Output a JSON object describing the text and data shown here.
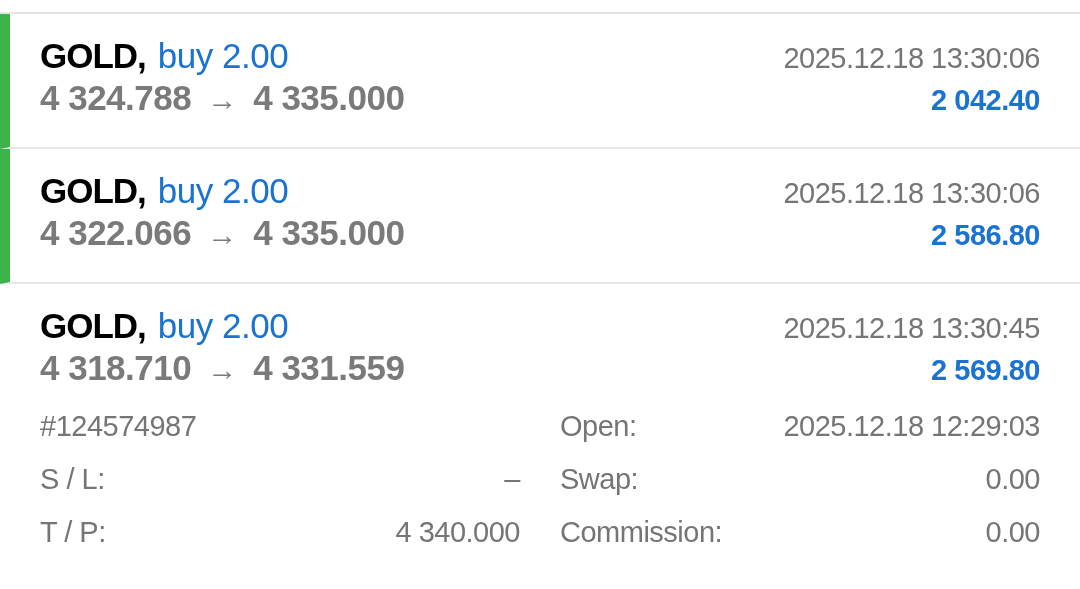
{
  "trades": [
    {
      "symbol": "GOLD,",
      "type": "buy",
      "volume": "2.00",
      "open_price": "4 324.788",
      "arrow": "→",
      "close_price": "4 335.000",
      "time": "2025.12.18 13:30:06",
      "profit": "2 042.40",
      "marked": true,
      "expanded": false
    },
    {
      "symbol": "GOLD,",
      "type": "buy",
      "volume": "2.00",
      "open_price": "4 322.066",
      "arrow": "→",
      "close_price": "4 335.000",
      "time": "2025.12.18 13:30:06",
      "profit": "2 586.80",
      "marked": true,
      "expanded": false
    },
    {
      "symbol": "GOLD,",
      "type": "buy",
      "volume": "2.00",
      "open_price": "4 318.710",
      "arrow": "→",
      "close_price": "4 331.559",
      "time": "2025.12.18 13:30:45",
      "profit": "2 569.80",
      "marked": false,
      "expanded": true,
      "details": [
        {
          "label": "#124574987"
        },
        {
          "label": "Open:",
          "value": "2025.12.18 12:29:03"
        },
        {
          "label": "S / L:",
          "value": "–"
        },
        {
          "label": "Swap:",
          "value": "0.00"
        },
        {
          "label": "T / P:",
          "value": "4 340.000"
        },
        {
          "label": "Commission:",
          "value": "0.00"
        }
      ]
    }
  ]
}
